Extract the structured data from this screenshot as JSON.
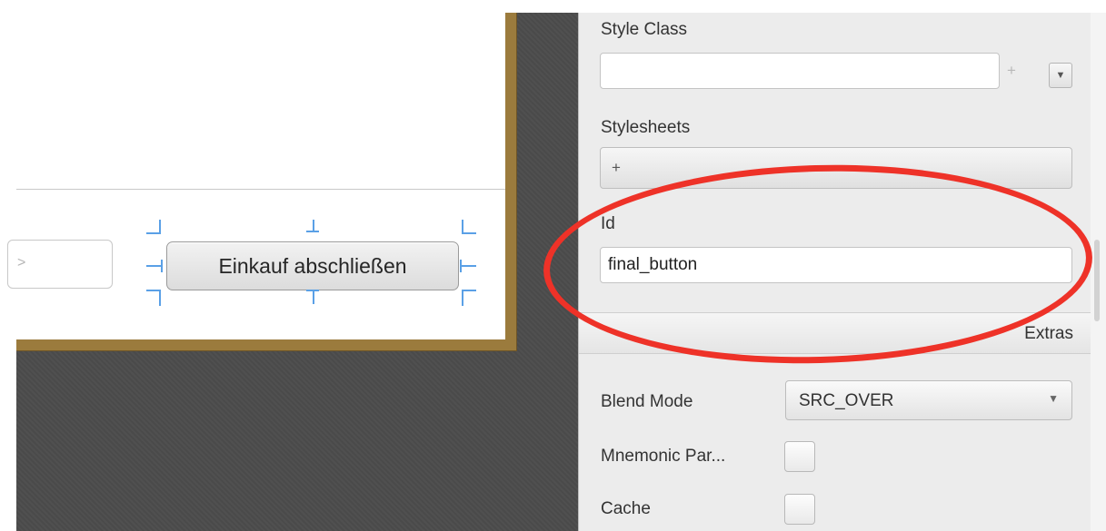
{
  "canvas": {
    "partial_field_text": ">",
    "selected_button_label": "Einkauf abschließen"
  },
  "inspector": {
    "style_class": {
      "label": "Style Class",
      "value": "",
      "add_label": "+",
      "dropdown_icon": "triangle-down"
    },
    "stylesheets": {
      "label": "Stylesheets",
      "add_label": "+"
    },
    "id": {
      "label": "Id",
      "value": "final_button"
    },
    "extras_section": {
      "label": "Extras"
    },
    "blend_mode": {
      "label": "Blend Mode",
      "value": "SRC_OVER"
    },
    "mnemonic_parsing": {
      "label": "Mnemonic Par...",
      "checked": false
    },
    "cache": {
      "label": "Cache",
      "checked": false
    }
  },
  "colors": {
    "annotation_red": "#ee3228",
    "selection_blue": "#5aa0e6",
    "preview_border": "#9b7b3d",
    "canvas_dark": "#4a4a4a"
  }
}
